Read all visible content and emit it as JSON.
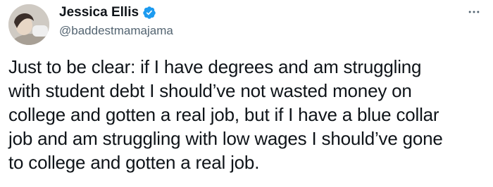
{
  "author": {
    "display_name": "Jessica Ellis",
    "handle": "@baddestmamajama",
    "verified": true
  },
  "icons": {
    "verified": "verified-badge-icon",
    "more": "more-horizontal-icon"
  },
  "colors": {
    "verified_badge": "#1d9bf0",
    "text_primary": "#0f1419",
    "text_secondary": "#536471"
  },
  "tweet": {
    "text": "Just to be clear: if I have degrees and am struggling\nwith student debt I should’ve not wasted money on\ncollege and gotten a real job, but if I have a blue collar\njob and am struggling with low wages I should’ve gone\nto college and gotten a real job."
  }
}
